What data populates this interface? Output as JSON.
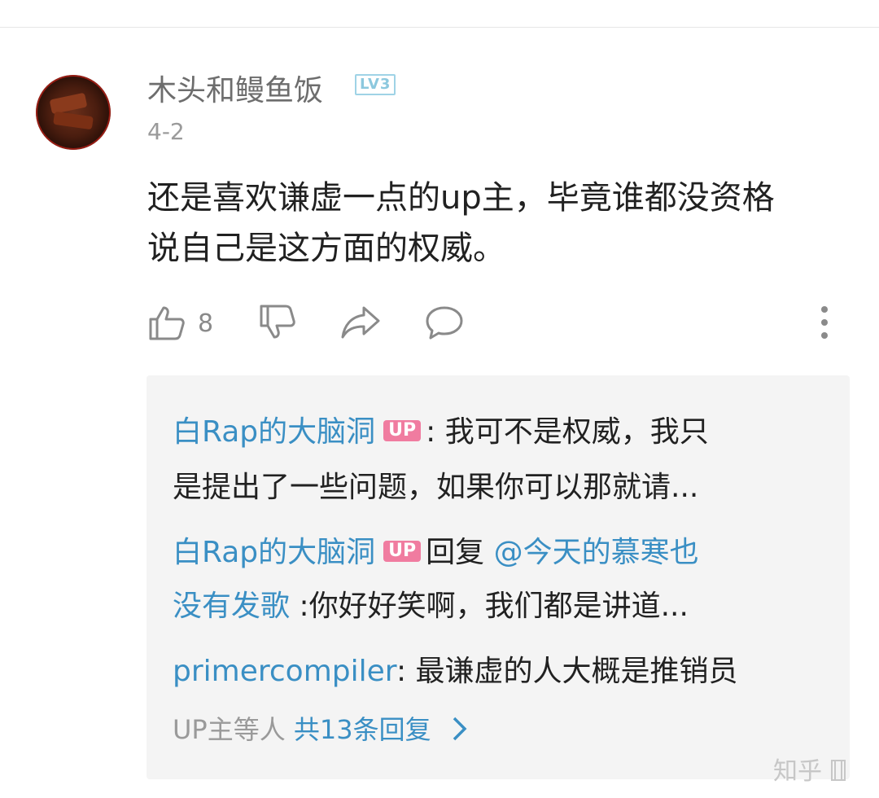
{
  "comment": {
    "username": "木头和鳗鱼饭",
    "level_badge": "LV3",
    "date": "4-2",
    "text_line1": "还是喜欢谦虚一点的up主，毕竟谁都没资格",
    "text_line2": "说自己是这方面的权威。",
    "like_count": "8"
  },
  "replies": {
    "items": [
      {
        "author": "白Rap的大脑洞",
        "badge": "UP",
        "sep": ":",
        "text_line1": "我可不是权威，我只",
        "text_line2": "是提出了一些问题，如果你可以那就请..."
      },
      {
        "author": "白Rap的大脑洞",
        "badge": "UP",
        "reply_word": "回复",
        "mention_line1": "@今天的慕寒也",
        "mention_line2": "没有发歌",
        "text": ":你好好笑啊，我们都是讲道..."
      },
      {
        "author": "primercompiler",
        "text": ": 最谦虚的人大概是推销员"
      }
    ],
    "more_prefix": "UP主等人",
    "more_count": "共13条回复"
  },
  "watermark": "知乎",
  "icons": [
    "thumb-up-icon",
    "thumb-down-icon",
    "share-icon",
    "comment-icon",
    "more-vertical-icon",
    "chevron-right-icon"
  ],
  "colors": {
    "link": "#3a8fc4",
    "up_badge": "#f07ca0",
    "level_badge": "#9fd3e6",
    "reply_bg": "#f4f4f4"
  }
}
